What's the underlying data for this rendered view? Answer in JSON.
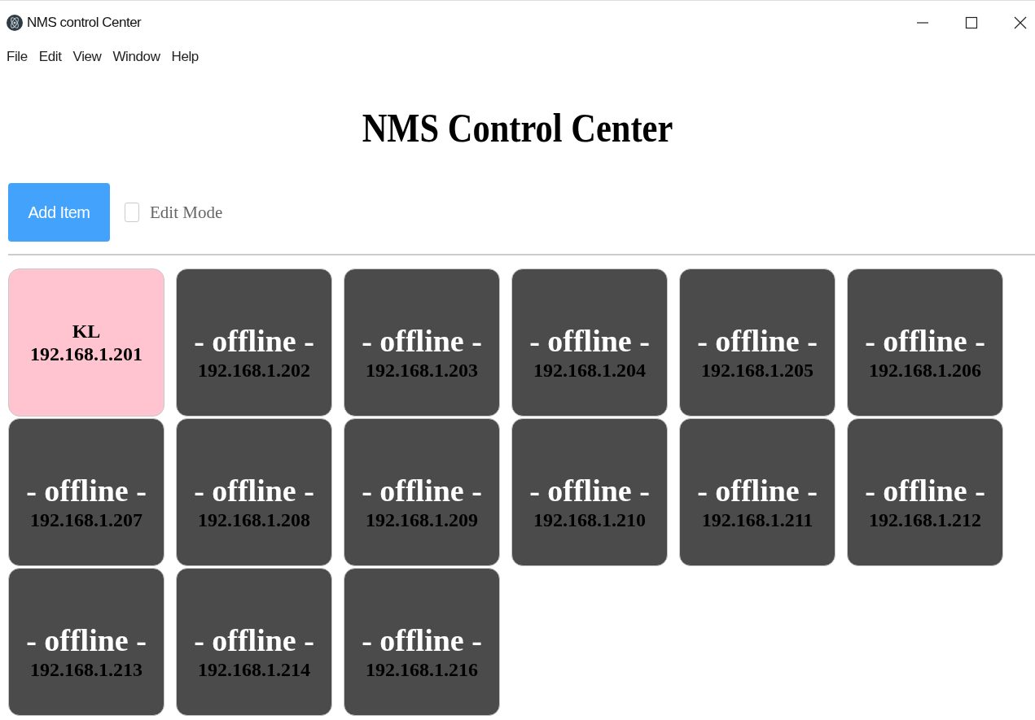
{
  "window": {
    "title": "NMS control Center"
  },
  "menu": [
    "File",
    "Edit",
    "View",
    "Window",
    "Help"
  ],
  "heading": "NMS Control Center",
  "toolbar": {
    "add_button": "Add Item",
    "edit_mode": {
      "label": "Edit Mode",
      "checked": false
    }
  },
  "devices": [
    {
      "name": "KL",
      "ip": "192.168.1.201",
      "online": true
    },
    {
      "ip": "192.168.1.202",
      "online": false,
      "status": "- offline -"
    },
    {
      "ip": "192.168.1.203",
      "online": false,
      "status": "- offline -"
    },
    {
      "ip": "192.168.1.204",
      "online": false,
      "status": "- offline -"
    },
    {
      "ip": "192.168.1.205",
      "online": false,
      "status": "- offline -"
    },
    {
      "ip": "192.168.1.206",
      "online": false,
      "status": "- offline -"
    },
    {
      "ip": "192.168.1.207",
      "online": false,
      "status": "- offline -"
    },
    {
      "ip": "192.168.1.208",
      "online": false,
      "status": "- offline -"
    },
    {
      "ip": "192.168.1.209",
      "online": false,
      "status": "- offline -"
    },
    {
      "ip": "192.168.1.210",
      "online": false,
      "status": "- offline -"
    },
    {
      "ip": "192.168.1.211",
      "online": false,
      "status": "- offline -"
    },
    {
      "ip": "192.168.1.212",
      "online": false,
      "status": "- offline -"
    },
    {
      "ip": "192.168.1.213",
      "online": false,
      "status": "- offline -"
    },
    {
      "ip": "192.168.1.214",
      "online": false,
      "status": "- offline -"
    },
    {
      "ip": "192.168.1.216",
      "online": false,
      "status": "- offline -"
    }
  ]
}
